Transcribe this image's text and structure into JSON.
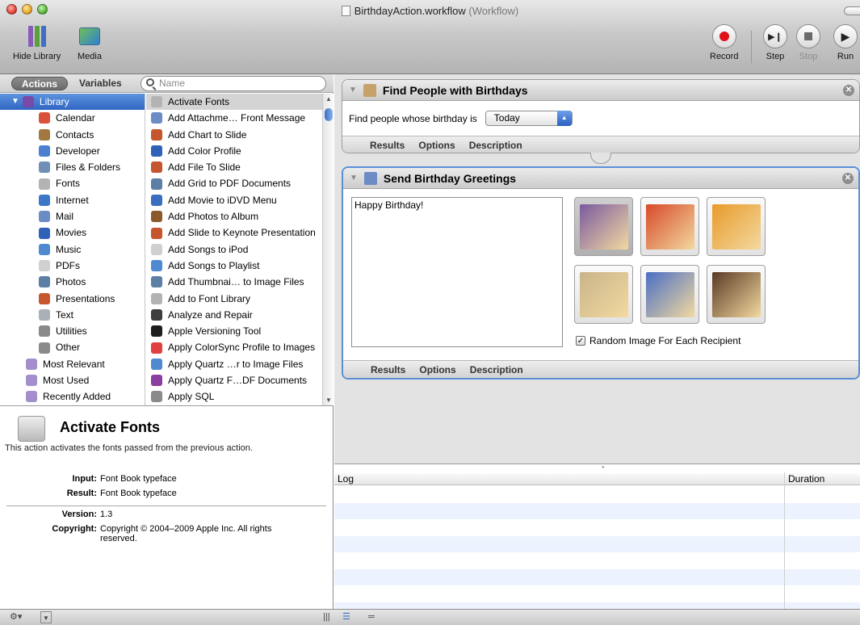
{
  "window": {
    "title": "BirthdayAction.workflow",
    "subtitle": "(Workflow)"
  },
  "toolbar": {
    "hide_library": "Hide Library",
    "media": "Media",
    "record": "Record",
    "step": "Step",
    "stop": "Stop",
    "run": "Run"
  },
  "library": {
    "tab_actions": "Actions",
    "tab_variables": "Variables",
    "search_placeholder": "Name",
    "categories": [
      {
        "label": "Library",
        "color": "#7a4aa8"
      },
      {
        "label": "Calendar",
        "color": "#d9533b"
      },
      {
        "label": "Contacts",
        "color": "#a07840"
      },
      {
        "label": "Developer",
        "color": "#4a7fd1"
      },
      {
        "label": "Files & Folders",
        "color": "#6f8fb6"
      },
      {
        "label": "Fonts",
        "color": "#b3b3b3"
      },
      {
        "label": "Internet",
        "color": "#3b78c8"
      },
      {
        "label": "Mail",
        "color": "#6b8cc4"
      },
      {
        "label": "Movies",
        "color": "#2f62b7"
      },
      {
        "label": "Music",
        "color": "#4f8ad1"
      },
      {
        "label": "PDFs",
        "color": "#d0d0d0"
      },
      {
        "label": "Photos",
        "color": "#5d7ea5"
      },
      {
        "label": "Presentations",
        "color": "#c5562e"
      },
      {
        "label": "Text",
        "color": "#aab0b7"
      },
      {
        "label": "Utilities",
        "color": "#8a8a8a"
      },
      {
        "label": "Other",
        "color": "#8a8a8a"
      },
      {
        "label": "Most Relevant",
        "color": "#a38fc9"
      },
      {
        "label": "Most Used",
        "color": "#a38fc9"
      },
      {
        "label": "Recently Added",
        "color": "#a38fc9"
      }
    ],
    "actions": [
      {
        "label": "Activate Fonts",
        "color": "#b3b3b3"
      },
      {
        "label": "Add Attachme… Front Message",
        "color": "#6b8cc4"
      },
      {
        "label": "Add Chart to Slide",
        "color": "#c5562e"
      },
      {
        "label": "Add Color Profile",
        "color": "#2f62b7"
      },
      {
        "label": "Add File To Slide",
        "color": "#c5562e"
      },
      {
        "label": "Add Grid to PDF Documents",
        "color": "#5d7ea5"
      },
      {
        "label": "Add Movie to iDVD Menu",
        "color": "#3a6fbf"
      },
      {
        "label": "Add Photos to Album",
        "color": "#8b5a2b"
      },
      {
        "label": "Add Slide to Keynote Presentation",
        "color": "#c5562e"
      },
      {
        "label": "Add Songs to iPod",
        "color": "#d0d0d0"
      },
      {
        "label": "Add Songs to Playlist",
        "color": "#4f8ad1"
      },
      {
        "label": "Add Thumbnai… to Image Files",
        "color": "#5d7ea5"
      },
      {
        "label": "Add to Font Library",
        "color": "#b3b3b3"
      },
      {
        "label": "Analyze and Repair",
        "color": "#3d3d3d"
      },
      {
        "label": "Apple Versioning Tool",
        "color": "#1e1e1e"
      },
      {
        "label": "Apply ColorSync Profile to Images",
        "color": "#e04040"
      },
      {
        "label": "Apply Quartz …r to Image Files",
        "color": "#4f8ad1"
      },
      {
        "label": "Apply Quartz F…DF Documents",
        "color": "#8a3fa0"
      },
      {
        "label": "Apply SQL",
        "color": "#8a8a8a"
      }
    ]
  },
  "description": {
    "title": "Activate Fonts",
    "text": "This action activates the fonts passed from the previous action.",
    "input_label": "Input:",
    "input_value": "Font Book typeface",
    "result_label": "Result:",
    "result_value": "Font Book typeface",
    "version_label": "Version:",
    "version_value": "1.3",
    "copyright_label": "Copyright:",
    "copyright_value": "Copyright © 2004–2009 Apple Inc. All rights reserved."
  },
  "workflow": {
    "action1": {
      "title": "Find People with Birthdays",
      "field_label": "Find people whose birthday is",
      "field_value": "Today",
      "tabs": [
        "Results",
        "Options",
        "Description"
      ]
    },
    "action2": {
      "title": "Send Birthday Greetings",
      "message": "Happy Birthday!",
      "checkbox_label": "Random Image For Each Recipient",
      "tabs": [
        "Results",
        "Options",
        "Description"
      ],
      "images": [
        {
          "name": "cake-with-candles",
          "color": "#7a5aa0"
        },
        {
          "name": "balloons",
          "color": "#d84a2a"
        },
        {
          "name": "candles-fire",
          "color": "#e89a2a"
        },
        {
          "name": "old-man-portrait",
          "color": "#c9b48a"
        },
        {
          "name": "cupcake-checkerboard",
          "color": "#4a6fc4"
        },
        {
          "name": "chocolate-cake",
          "color": "#5a3a24"
        }
      ]
    }
  },
  "log": {
    "col_log": "Log",
    "col_duration": "Duration"
  }
}
